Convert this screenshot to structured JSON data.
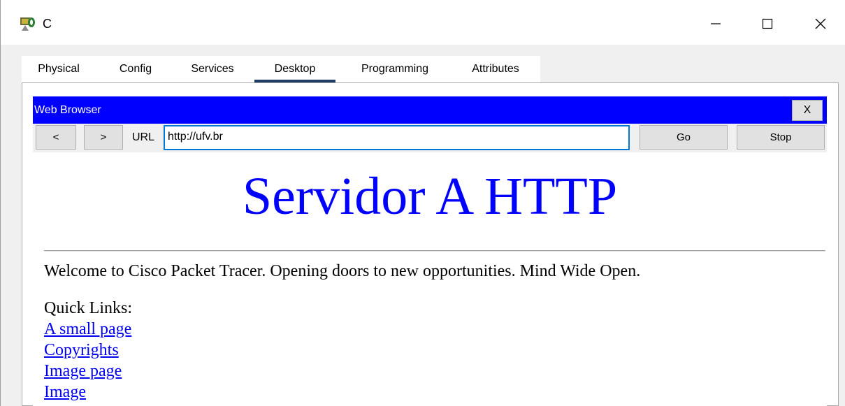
{
  "window": {
    "title": "C",
    "controls": {
      "minimize_icon": "minimize-icon",
      "maximize_icon": "maximize-icon",
      "close_icon": "close-icon"
    }
  },
  "tabs": [
    {
      "label": "Physical",
      "active": false
    },
    {
      "label": "Config",
      "active": false
    },
    {
      "label": "Services",
      "active": false
    },
    {
      "label": "Desktop",
      "active": true
    },
    {
      "label": "Programming",
      "active": false
    },
    {
      "label": "Attributes",
      "active": false
    }
  ],
  "browser": {
    "title": "Web Browser",
    "close_label": "X",
    "back_label": "<",
    "forward_label": ">",
    "url_label": "URL",
    "url_value": "http://ufv.br",
    "go_label": "Go",
    "stop_label": "Stop",
    "title_bar_color": "#0000ff"
  },
  "page": {
    "heading": "Servidor A HTTP",
    "heading_color": "#0000ff",
    "welcome": "Welcome to Cisco Packet Tracer. Opening doors to new opportunities. Mind Wide Open.",
    "quick_links_label": "Quick Links:",
    "links": [
      "A small page",
      "Copyrights",
      "Image page",
      "Image"
    ],
    "link_color": "#0000ee"
  }
}
